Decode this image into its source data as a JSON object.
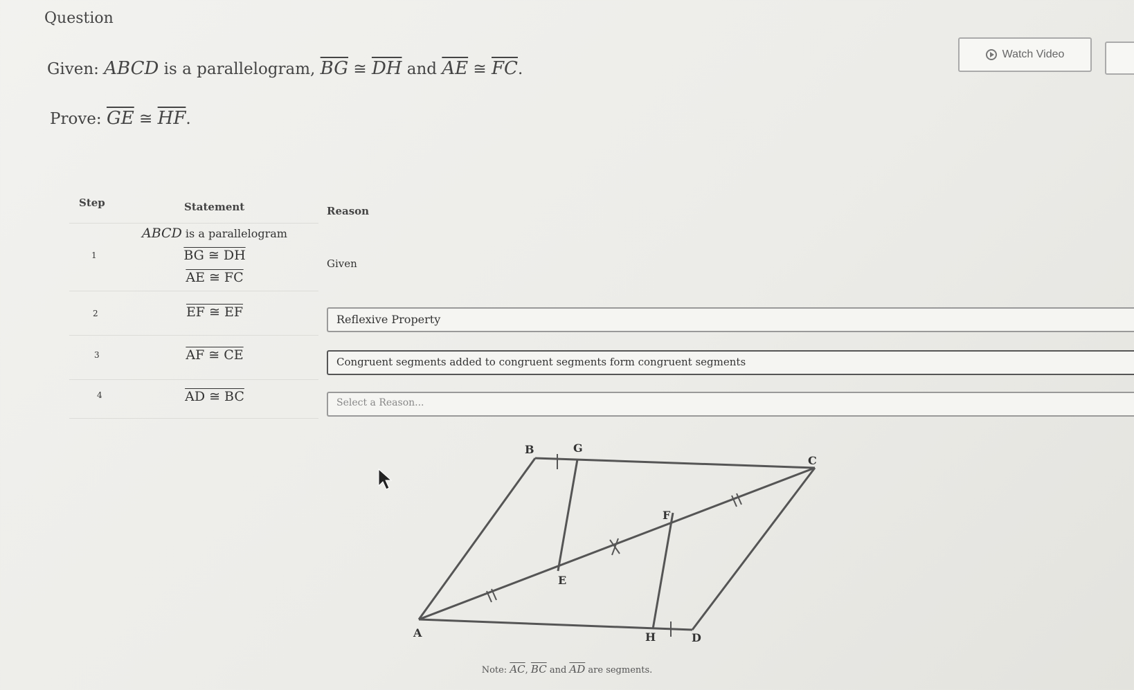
{
  "header": {
    "title": "Question"
  },
  "toolbar": {
    "watch_video_label": "Watch Video"
  },
  "problem": {
    "given_prefix": "Given: ",
    "given_shape": "ABCD",
    "given_mid": " is a parallelogram, ",
    "seg_bg": "BG",
    "seg_dh": "DH",
    "and_text": " and ",
    "seg_ae": "AE",
    "seg_fc": "FC",
    "congruent": " ≅ ",
    "period": ".",
    "prove_prefix": "Prove: ",
    "seg_ge": "GE",
    "seg_hf": "HF"
  },
  "table": {
    "headers": {
      "step": "Step",
      "statement": "Statement",
      "reason": "Reason"
    },
    "rows": [
      {
        "step": "1",
        "statement_lines": [
          "ABCD is a parallelogram",
          "BG ≅ DH",
          "AE ≅ FC"
        ],
        "reason": "Given"
      },
      {
        "step": "2",
        "statement": "EF ≅ EF",
        "reason": "Reflexive Property"
      },
      {
        "step": "3",
        "statement": "AF ≅ CE",
        "reason": "Congruent segments added to congruent segments form congruent segments"
      },
      {
        "step": "4",
        "statement": "AD ≅ BC",
        "reason_placeholder": "Select a Reason..."
      }
    ]
  },
  "diagram": {
    "labels": {
      "A": "A",
      "B": "B",
      "C": "C",
      "D": "D",
      "E": "E",
      "F": "F",
      "G": "G",
      "H": "H"
    },
    "line_color": "#555555"
  },
  "note": {
    "prefix": "Note: ",
    "seg_ac": "AC",
    "comma": ", ",
    "seg_bc": "BC",
    "and_text": " and ",
    "seg_ad": "AD",
    "suffix": " are segments."
  }
}
